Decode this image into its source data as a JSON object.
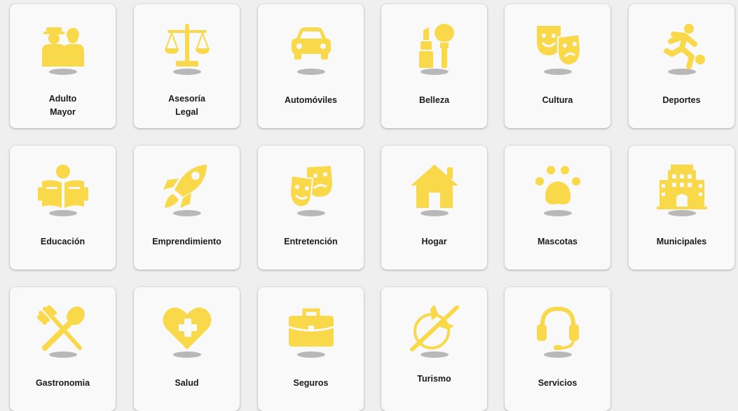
{
  "accent_color": "#f9d94a",
  "categories": [
    {
      "label": "Adulto\nMayor",
      "icon": "elderly-icon"
    },
    {
      "label": "Asesoría\nLegal",
      "icon": "scales-icon"
    },
    {
      "label": "Automóviles",
      "icon": "car-icon"
    },
    {
      "label": "Belleza",
      "icon": "makeup-icon"
    },
    {
      "label": "Cultura",
      "icon": "theater-masks-icon"
    },
    {
      "label": "Deportes",
      "icon": "soccer-player-icon"
    },
    {
      "label": "Educación",
      "icon": "reading-icon"
    },
    {
      "label": "Emprendimiento",
      "icon": "rocket-icon"
    },
    {
      "label": "Entretención",
      "icon": "theater-masks-icon"
    },
    {
      "label": "Hogar",
      "icon": "house-icon"
    },
    {
      "label": "Mascotas",
      "icon": "paw-icon"
    },
    {
      "label": "Municipales",
      "icon": "building-icon"
    },
    {
      "label": "Gastronomia",
      "icon": "fork-spoon-icon"
    },
    {
      "label": "Salud",
      "icon": "heart-plus-icon"
    },
    {
      "label": "Seguros",
      "icon": "briefcase-icon"
    },
    {
      "label": "Turismo",
      "icon": "airplane-globe-icon"
    },
    {
      "label": "Servicios",
      "icon": "headset-icon"
    }
  ]
}
